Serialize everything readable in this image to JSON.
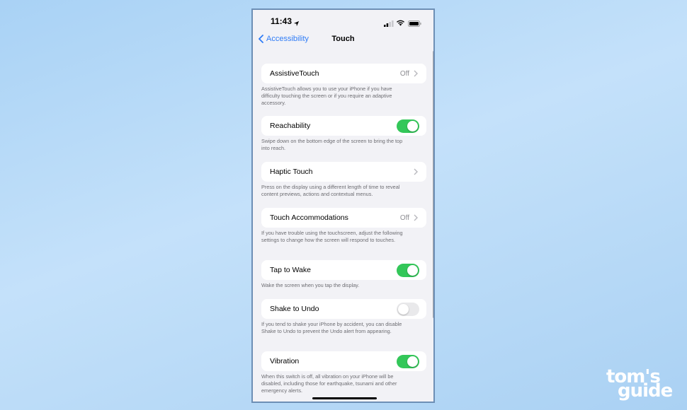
{
  "status_bar": {
    "time": "11:43"
  },
  "nav": {
    "back_label": "Accessibility",
    "title": "Touch"
  },
  "rows": [
    {
      "label": "AssistiveTouch",
      "value": "Off",
      "footer": "AssistiveTouch allows you to use your iPhone if you have difficulty touching the screen or if you require an adaptive accessory."
    },
    {
      "label": "Reachability",
      "toggle": true,
      "footer": "Swipe down on the bottom edge of the screen to bring the top into reach."
    },
    {
      "label": "Haptic Touch",
      "footer": "Press on the display using a different length of time to reveal content previews, actions and contextual menus."
    },
    {
      "label": "Touch Accommodations",
      "value": "Off",
      "footer": "If you have trouble using the touchscreen, adjust the following settings to change how the screen will respond to touches."
    },
    {
      "label": "Tap to Wake",
      "toggle": true,
      "footer": "Wake the screen when you tap the display."
    },
    {
      "label": "Shake to Undo",
      "toggle": false,
      "footer": "If you tend to shake your iPhone by accident, you can disable Shake to Undo to prevent the Undo alert from appearing."
    },
    {
      "label": "Vibration",
      "toggle": true,
      "footer": "When this switch is off, all vibration on your iPhone will be disabled, including those for earthquake, tsunami and other emergency alerts."
    }
  ],
  "watermark": {
    "line1": "tom's",
    "line2": "guide"
  },
  "colors": {
    "accent": "#2f7cf6",
    "toggle_on": "#33c759",
    "background": "#f2f2f6"
  }
}
